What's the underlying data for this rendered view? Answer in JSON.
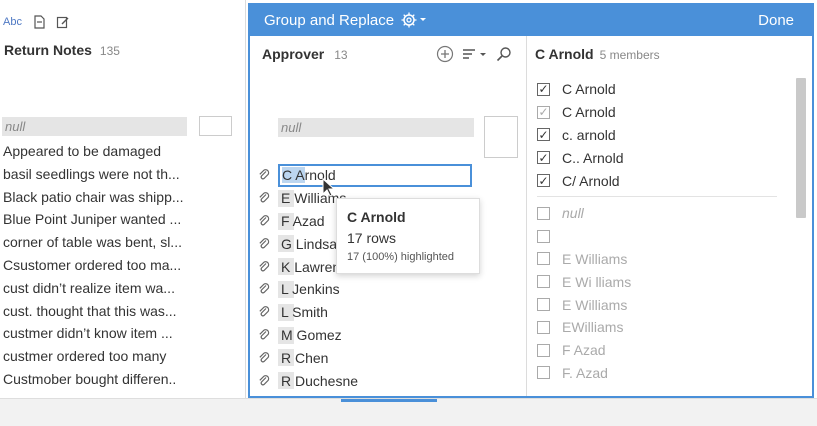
{
  "left": {
    "icons": [
      "abc-type-icon",
      "document-icon",
      "edit-icon"
    ],
    "abc_label": "Abc",
    "title": "Return Notes",
    "count": "135",
    "null_label": "null",
    "rows": [
      "Appeared to be damaged",
      "basil seedlings were not th...",
      "Black patio chair was shipp...",
      "Blue Point Juniper wanted ...",
      "corner of table was bent, sl...",
      "Csustomer ordered too ma...",
      "cust didn’t realize item wa...",
      "cust. thought that this was...",
      "custmer didn’t know item ...",
      "custmer ordered too many",
      "Custmober bought differen.."
    ]
  },
  "panel": {
    "title": "Group and Replace",
    "done_label": "Done",
    "colors": {
      "accent": "#4a90d9"
    }
  },
  "middle": {
    "title": "Approver",
    "count": "13",
    "null_label": "null",
    "selected": {
      "hl": "C A",
      "rest": "rnold"
    },
    "rows": [
      "E Williams",
      "F Azad",
      "G Lindsay",
      "K Lawrence",
      "L Jenkins",
      "L Smith",
      "M Gomez",
      "R Chen",
      "R Duchesne"
    ]
  },
  "tooltip": {
    "name": "C Arnold",
    "rows": "17 rows",
    "highlighted": "17 (100%) highlighted"
  },
  "right": {
    "title": "C Arnold",
    "members": "5 members",
    "members_list": [
      {
        "label": "C  Arnold",
        "checked": true,
        "light": false
      },
      {
        "label": "C Arnold",
        "checked": true,
        "light": true
      },
      {
        "label": "c. arnold",
        "checked": true,
        "light": false
      },
      {
        "label": "C.. Arnold",
        "checked": true,
        "light": false
      },
      {
        "label": "C/ Arnold",
        "checked": true,
        "light": false
      }
    ],
    "others": [
      {
        "label": "null",
        "style": "null"
      },
      {
        "label": "",
        "style": "plain"
      },
      {
        "label": "E   Williams",
        "style": "dim"
      },
      {
        "label": "E Wi lliams",
        "style": "dim"
      },
      {
        "label": "E Williams",
        "style": "dim"
      },
      {
        "label": "EWilliams",
        "style": "dim"
      },
      {
        "label": "F Azad",
        "style": "dim"
      },
      {
        "label": "F. Azad",
        "style": "dim"
      }
    ]
  }
}
